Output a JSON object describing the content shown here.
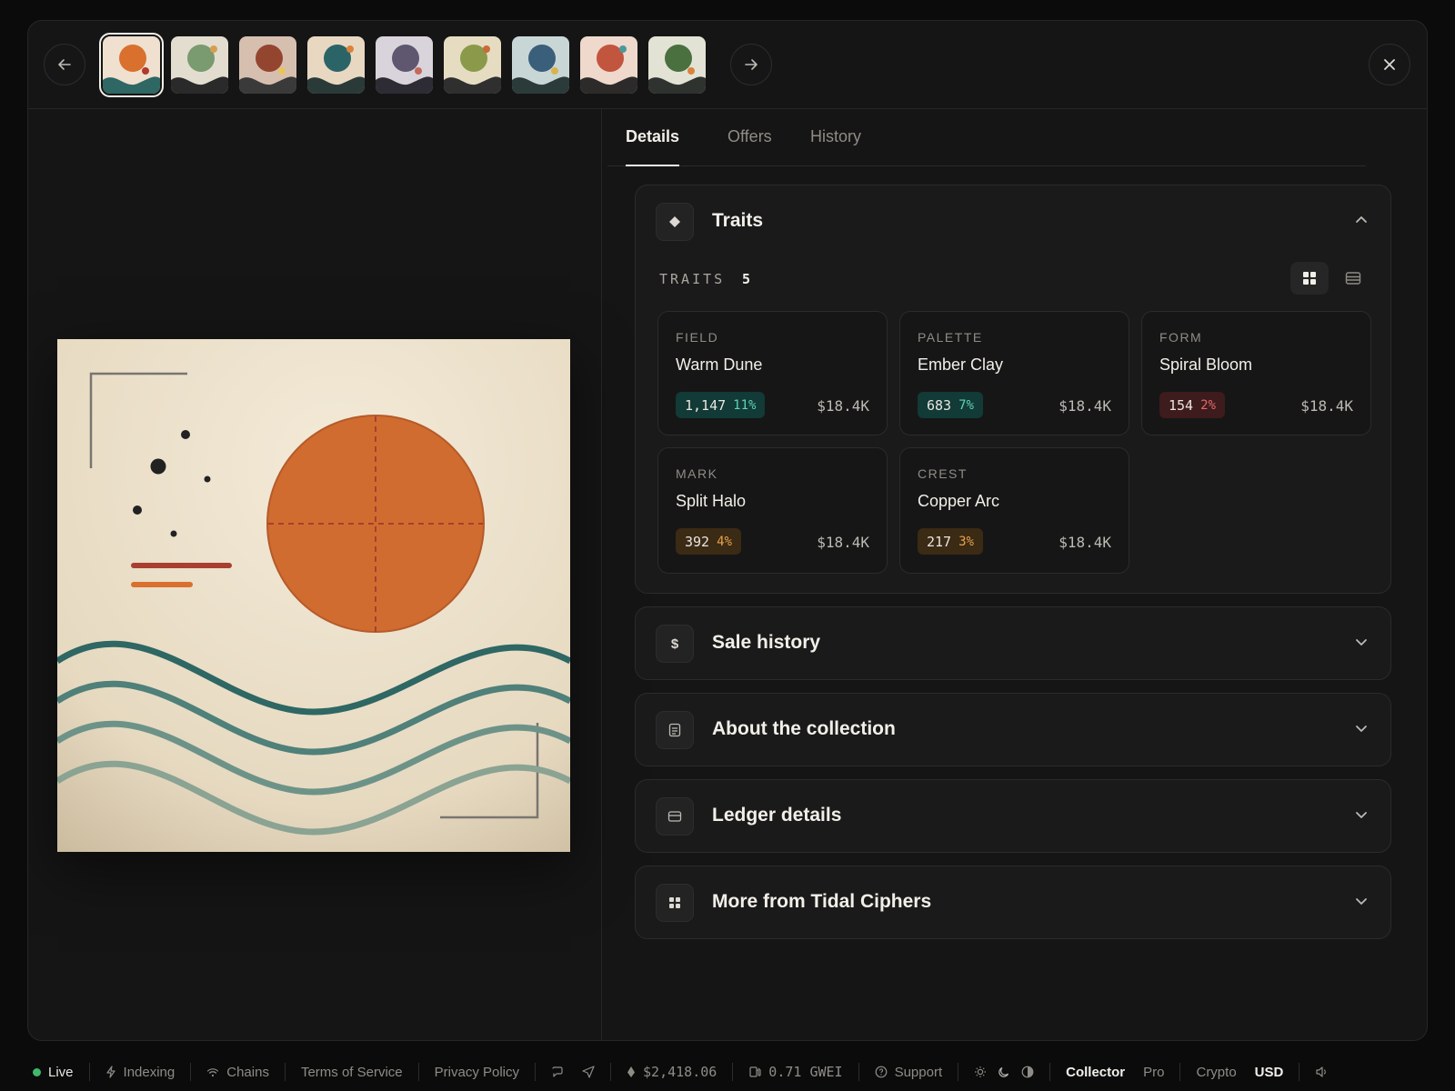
{
  "topbar": {
    "thumbnails": [
      {
        "bg": "#efe0cf",
        "sun": "#d9702e",
        "wave": "#2e6763",
        "dot": "#b03a2b"
      },
      {
        "bg": "#e3ddd0",
        "sun": "#7a9a6f",
        "wave": "#2a2a2a",
        "dot": "#d69f50"
      },
      {
        "bg": "#d7bfb0",
        "sun": "#944530",
        "wave": "#3a3a3a",
        "dot": "#e8c55a"
      },
      {
        "bg": "#e8d8c2",
        "sun": "#2b6466",
        "wave": "#2a3a38",
        "dot": "#d9833d"
      },
      {
        "bg": "#d9d4db",
        "sun": "#5f5670",
        "wave": "#2d2b33",
        "dot": "#c46a5d"
      },
      {
        "bg": "#e6dcc2",
        "sun": "#8a9a4a",
        "wave": "#2f2f2f",
        "dot": "#c86b38"
      },
      {
        "bg": "#c9d6d6",
        "sun": "#3a5f7a",
        "wave": "#2b3b3a",
        "dot": "#d8b44c"
      },
      {
        "bg": "#efd8cc",
        "sun": "#c2553e",
        "wave": "#2d2b2a",
        "dot": "#4a9a9a"
      },
      {
        "bg": "#e3e3d5",
        "sun": "#4a7040",
        "wave": "#2f3330",
        "dot": "#d9833d"
      }
    ]
  },
  "tabs": [
    {
      "label": "Details"
    },
    {
      "label": "Offers"
    },
    {
      "label": "History"
    }
  ],
  "traits": {
    "title": "Traits",
    "label": "TRAITS",
    "count": "5",
    "cards": [
      {
        "category": "FIELD",
        "value": "Warm Dune",
        "count": "1,147",
        "pct": "11%",
        "price": "$18.4K",
        "tone": "teal"
      },
      {
        "category": "PALETTE",
        "value": "Ember Clay",
        "count": "683",
        "pct": "7%",
        "price": "$18.4K",
        "tone": "teal"
      },
      {
        "category": "FORM",
        "value": "Spiral Bloom",
        "count": "154",
        "pct": "2%",
        "price": "$18.4K",
        "tone": "red"
      },
      {
        "category": "MARK",
        "value": "Split Halo",
        "count": "392",
        "pct": "4%",
        "price": "$18.4K",
        "tone": "amber"
      },
      {
        "category": "CREST",
        "value": "Copper Arc",
        "count": "217",
        "pct": "3%",
        "price": "$18.4K",
        "tone": "amber"
      }
    ]
  },
  "sections": [
    {
      "title": "Sale history",
      "icon": "dollar-icon"
    },
    {
      "title": "About the collection",
      "icon": "document-icon"
    },
    {
      "title": "Ledger details",
      "icon": "card-icon"
    },
    {
      "title": "More from Tidal Ciphers",
      "icon": "grid-icon"
    }
  ],
  "status": {
    "live": "Live",
    "indexing": "Indexing",
    "chains": "Chains",
    "terms": "Terms of Service",
    "privacy": "Privacy Policy",
    "price": "$2,418.06",
    "gas": "0.71 GWEI",
    "support": "Support",
    "mode_collector": "Collector",
    "mode_pro": "Pro",
    "currency_crypto": "Crypto",
    "currency_usd": "USD"
  },
  "colors": {
    "teal_bg": "#123a36",
    "teal_fg": "#5fd3b8",
    "red_bg": "#3e1b1c",
    "red_fg": "#e06a6a",
    "amber_bg": "#3b2a14",
    "amber_fg": "#e8a24b"
  }
}
